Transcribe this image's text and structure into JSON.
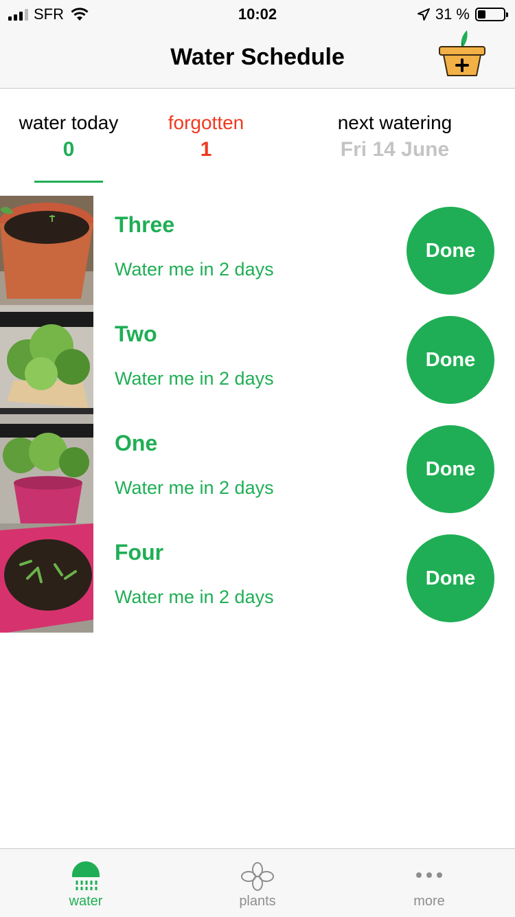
{
  "status_bar": {
    "carrier": "SFR",
    "time": "10:02",
    "battery_percent": "31 %",
    "battery_level": 0.31,
    "icons": [
      "signal-icon",
      "wifi-icon",
      "location-arrow-icon",
      "battery-icon"
    ]
  },
  "nav": {
    "title": "Water Schedule",
    "add_icon": "plant-pot-plus-icon"
  },
  "summary": {
    "today_label": "water today",
    "today_value": "0",
    "forgotten_label": "forgotten",
    "forgotten_value": "1",
    "next_label": "next watering",
    "next_value": "Fri 14 June",
    "selected_tab": "water today"
  },
  "plants": [
    {
      "name": "Three",
      "status": "Water me in 2 days",
      "button": "Done",
      "pot_color": "#d9613b"
    },
    {
      "name": "Two",
      "status": "Water me in 2 days",
      "button": "Done",
      "pot_color": "#e6c48a"
    },
    {
      "name": "One",
      "status": "Water me in 2 days",
      "button": "Done",
      "pot_color": "#c8336f"
    },
    {
      "name": "Four",
      "status": "Water me in 2 days",
      "button": "Done",
      "pot_color": "#d6336e"
    }
  ],
  "tabs": [
    {
      "label": "water",
      "icon": "watering-can-icon",
      "active": true
    },
    {
      "label": "plants",
      "icon": "flower-icon",
      "active": false
    },
    {
      "label": "more",
      "icon": "more-dots-icon",
      "active": false
    }
  ],
  "colors": {
    "accent": "#1fae55",
    "alert": "#f0391f",
    "muted": "#c4c4c4"
  }
}
